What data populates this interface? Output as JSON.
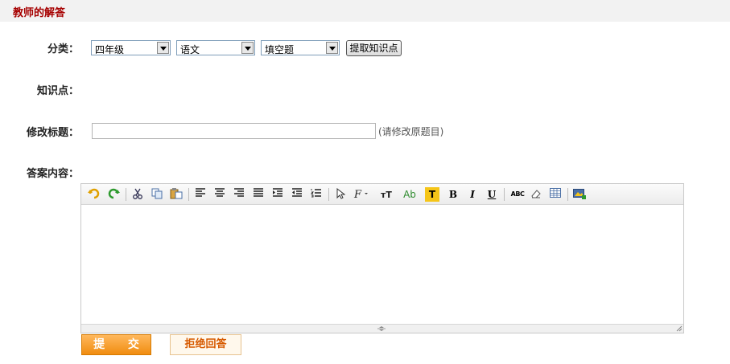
{
  "header": {
    "title": "教师的解答"
  },
  "classification": {
    "label": "分类：",
    "grade": "四年级",
    "subject": "语文",
    "question_type": "填空题",
    "extract_button": "提取知识点"
  },
  "knowledge": {
    "label": "知识点："
  },
  "title_edit": {
    "label": "修改标题：",
    "value": "",
    "hint": "(请修改原题目)"
  },
  "answer": {
    "label": "答案内容："
  },
  "toolbar": {
    "font_size_glyph": "тT",
    "text_color_glyph": "Ab",
    "highlight_glyph": "T",
    "bold_glyph": "B",
    "italic_glyph": "I",
    "underline_glyph": "U",
    "spellcheck_glyph": "ABC"
  },
  "actions": {
    "submit": "提 交",
    "reject": "拒绝回答"
  },
  "colors": {
    "accent": "#f08c10",
    "header_title": "#a60000",
    "reject_text": "#d75a00"
  }
}
